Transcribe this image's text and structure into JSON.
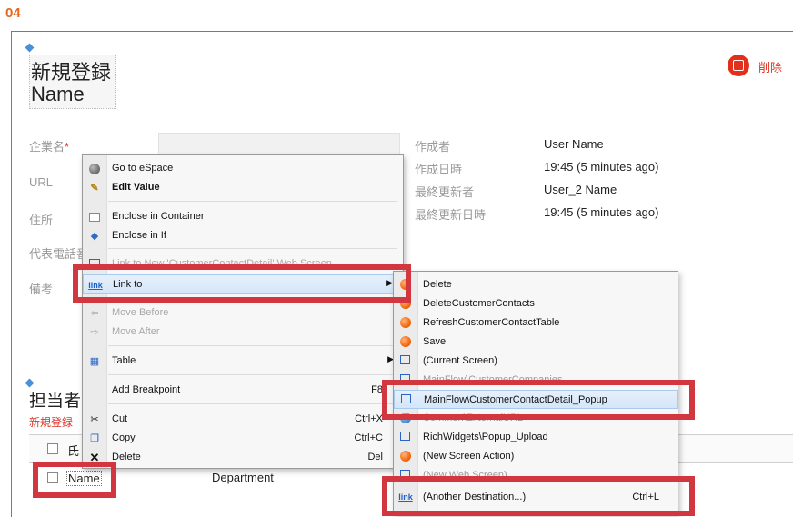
{
  "step": "04",
  "screen": {
    "title_line1": "新規登録",
    "title_line2": "Name",
    "delete_label": "削除"
  },
  "form": {
    "fields": [
      {
        "label": "企業名",
        "required_mark": "*"
      },
      {
        "label": "URL"
      },
      {
        "label": "住所"
      },
      {
        "label": "代表電話番"
      },
      {
        "label": "備考"
      }
    ],
    "audit": [
      {
        "label": "作成者",
        "value": "User Name"
      },
      {
        "label": "作成日時",
        "value": "19:45 (5 minutes ago)"
      },
      {
        "label": "最終更新者",
        "value": "User_2 Name"
      },
      {
        "label": "最終更新日時",
        "value": "19:45 (5 minutes ago)"
      }
    ]
  },
  "contacts": {
    "section_title": "担当者",
    "new_link": "新規登録",
    "header_col1": "氏",
    "row_name": "Name",
    "row_department": "Department"
  },
  "context_menu": {
    "items": [
      {
        "icon": "globe-icon",
        "label": "Go to eSpace"
      },
      {
        "icon": "edit-value-icon",
        "label": "Edit Value",
        "bold": true
      },
      {
        "icon": "container-icon",
        "label": "Enclose in Container"
      },
      {
        "icon": "diamond-icon",
        "label": "Enclose in If"
      },
      {
        "icon": "screen-icon",
        "label": "Link to New 'CustomerContactDetail' Web Screen"
      },
      {
        "icon": "link-icon",
        "label": "Link to",
        "submenu": true
      },
      {
        "icon": "arrow-left-icon",
        "label": "Move Before",
        "disabled": true
      },
      {
        "icon": "arrow-right-icon",
        "label": "Move After",
        "disabled": true
      },
      {
        "icon": "table-icon",
        "label": "Table",
        "submenu": true
      },
      {
        "icon": "",
        "label": "Add Breakpoint",
        "shortcut": "F8"
      },
      {
        "icon": "scissors-icon",
        "label": "Cut",
        "shortcut": "Ctrl+X"
      },
      {
        "icon": "copy-icon",
        "label": "Copy",
        "shortcut": "Ctrl+C"
      },
      {
        "icon": "delete-x-icon",
        "label": "Delete",
        "shortcut": "Del"
      }
    ],
    "link_icon_text": "link"
  },
  "submenu": {
    "items": [
      {
        "icon": "action-orb-icon",
        "label": "Delete"
      },
      {
        "icon": "action-orb-icon",
        "label": "DeleteCustomerContacts"
      },
      {
        "icon": "action-orb-icon",
        "label": "RefreshCustomerContactTable"
      },
      {
        "icon": "action-orb-icon",
        "label": "Save"
      },
      {
        "icon": "screen-icon",
        "label": "(Current Screen)"
      },
      {
        "icon": "screen-icon",
        "label": "MainFlow\\CustomerCompanies"
      },
      {
        "icon": "screen-icon",
        "label": "MainFlow\\CustomerContactDetail_Popup"
      },
      {
        "icon": "external-url-icon",
        "label": "Common\\ExternalURL"
      },
      {
        "icon": "screen-icon",
        "label": "RichWidgets\\Popup_Upload"
      },
      {
        "icon": "action-orb-icon",
        "label": "(New Screen Action)"
      },
      {
        "icon": "screen-icon",
        "label": "(New Web Screen)"
      },
      {
        "icon": "link-icon",
        "label": "(Another Destination...)",
        "shortcut": "Ctrl+L"
      }
    ]
  },
  "colors": {
    "accent_orange": "#e8661c",
    "highlight_red": "#d2373f",
    "delete_red": "#e3301c"
  }
}
